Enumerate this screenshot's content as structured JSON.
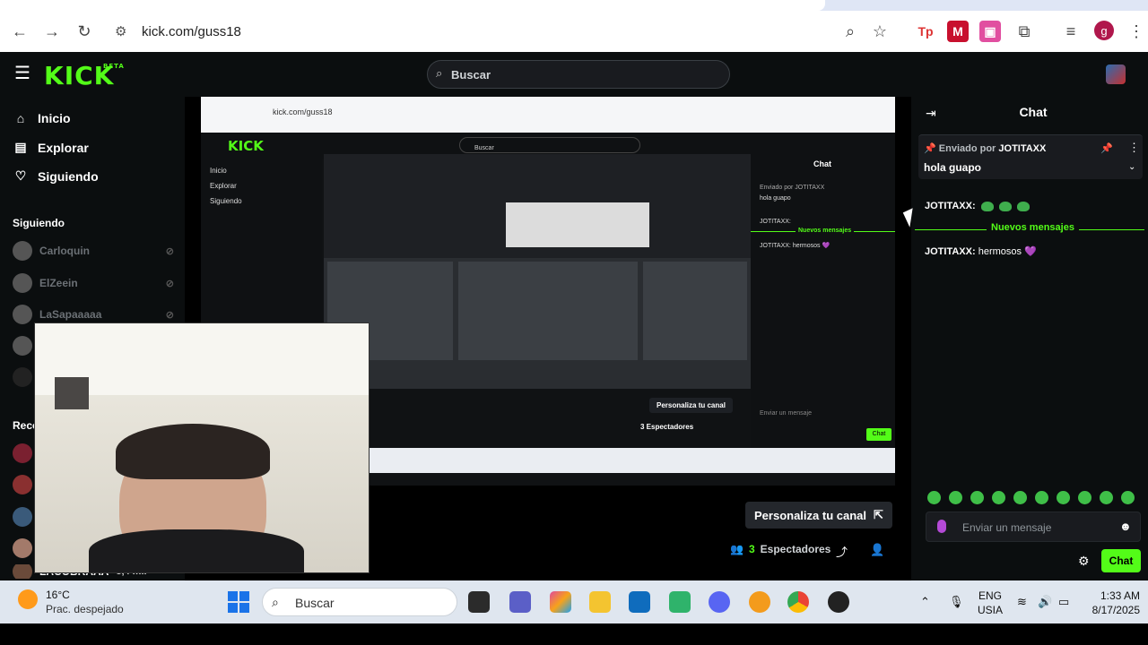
{
  "browser": {
    "url": "kick.com/guss18",
    "icons": [
      "back-icon",
      "forward-icon",
      "reload-icon",
      "site-info-icon",
      "zoom-icon",
      "bookmark-star-icon",
      "extensions-icon",
      "media-icon",
      "menu-icon"
    ],
    "profile_initial": "g"
  },
  "kick": {
    "logo": "KICK",
    "logo_badge": "BETA",
    "search_placeholder": "Buscar"
  },
  "sidebar": {
    "nav": [
      {
        "label": "Inicio",
        "icon": "home-icon"
      },
      {
        "label": "Explorar",
        "icon": "compass-icon"
      },
      {
        "label": "Siguiendo",
        "icon": "heart-icon"
      }
    ],
    "following_title": "Siguiendo",
    "following": [
      {
        "name": "Carloquin"
      },
      {
        "name": "ElZeein"
      },
      {
        "name": "LaSapaaaaa"
      }
    ],
    "recommended_title": "Reco",
    "bottom_name": "LACOBRAAA",
    "bottom_count": "8,4 mil"
  },
  "stream": {
    "personaliza_label": "Personaliza tu canal",
    "spectators_count": "3",
    "spectators_label": "Espectadores"
  },
  "chat": {
    "title": "Chat",
    "pinned_label": "Enviado por",
    "pinned_user": "JOTITAXX",
    "pinned_message": "hola guapo",
    "messages": [
      {
        "user": "JOTITAXX:",
        "text": ""
      },
      {
        "user": "JOTITAXX:",
        "text": "hermosos 💜"
      }
    ],
    "new_messages": "Nuevos mensajes",
    "input_placeholder": "Enviar un mensaje",
    "send_label": "Chat",
    "emote_color": "#3fbf48"
  },
  "taskbar": {
    "temperature": "16°C",
    "weather": "Prac. despejado",
    "search_placeholder": "Buscar",
    "lang_line1": "ENG",
    "lang_line2": "USIA",
    "time": "1:33 AM",
    "date": "8/17/2025"
  },
  "inner_capture": {
    "url": "kick.com/guss18",
    "logo": "KICK",
    "search": "Buscar",
    "nav": [
      "Inicio",
      "Explorar",
      "Siguiendo"
    ],
    "chat_title": "Chat",
    "pinned": "Enviado por JOTITAXX",
    "pinned_msg": "hola guapo",
    "new_messages": "Nuevos mensajes",
    "msg1": "JOTITAXX:",
    "msg2": "JOTITAXX: hermosos 💜",
    "personaliza": "Personaliza tu canal",
    "spectators": "3 Espectadores",
    "chat_btn": "Chat",
    "input": "Enviar un mensaje"
  },
  "colors": {
    "accent": "#53fc18",
    "background": "#0b0e0f"
  }
}
